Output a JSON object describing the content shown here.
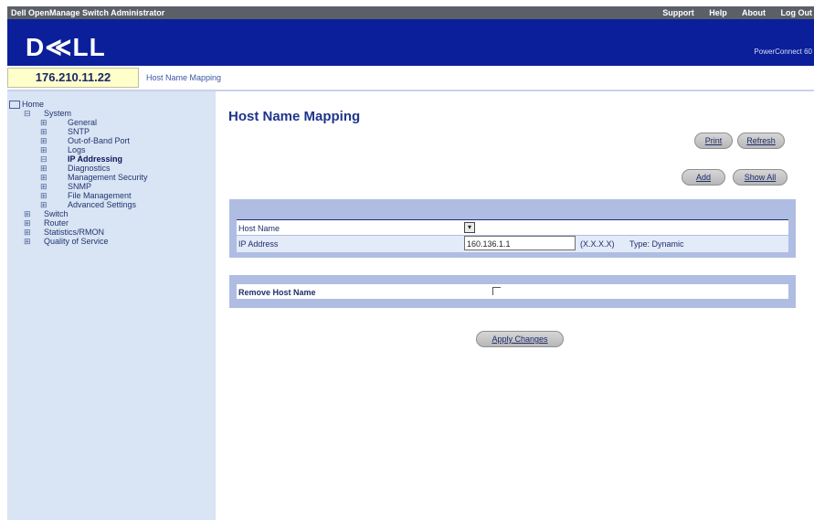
{
  "app_title": "Dell OpenManage Switch Administrator",
  "top_nav": [
    "Support",
    "Help",
    "About",
    "Log Out"
  ],
  "brand": {
    "logo": "D≪LL",
    "product": "PowerConnect 60"
  },
  "address": {
    "ip": "176.210.11.22",
    "breadcrumb": "Host Name Mapping"
  },
  "tree": [
    {
      "label": "Home",
      "level": 0,
      "prefix": ""
    },
    {
      "label": "System",
      "level": 1,
      "prefix": "⊟"
    },
    {
      "label": "General",
      "level": 2,
      "prefix": "⊞"
    },
    {
      "label": "SNTP",
      "level": 2,
      "prefix": "⊞"
    },
    {
      "label": "Out-of-Band Port",
      "level": 2,
      "prefix": "⊞"
    },
    {
      "label": "Logs",
      "level": 2,
      "prefix": "⊞"
    },
    {
      "label": "IP Addressing",
      "level": 2,
      "prefix": "⊟",
      "selected": true
    },
    {
      "label": "Diagnostics",
      "level": 2,
      "prefix": "⊞"
    },
    {
      "label": "Management Security",
      "level": 2,
      "prefix": "⊞"
    },
    {
      "label": "SNMP",
      "level": 2,
      "prefix": "⊞"
    },
    {
      "label": "File Management",
      "level": 2,
      "prefix": "⊞"
    },
    {
      "label": "Advanced Settings",
      "level": 2,
      "prefix": "⊞"
    },
    {
      "label": "Switch",
      "level": 1,
      "prefix": "⊞"
    },
    {
      "label": "Router",
      "level": 1,
      "prefix": "⊞"
    },
    {
      "label": "Statistics/RMON",
      "level": 1,
      "prefix": "⊞"
    },
    {
      "label": "Quality of Service",
      "level": 1,
      "prefix": "⊞"
    }
  ],
  "main": {
    "title": "Host Name Mapping",
    "buttons": {
      "print": "Print",
      "refresh": "Refresh",
      "add": "Add",
      "show_all": "Show All",
      "apply": "Apply Changes"
    },
    "form": {
      "host_name_label": "Host Name",
      "host_name_select": "▾",
      "ip_address_label": "IP Address",
      "ip_address_value": "160.136.1.1",
      "ip_hint": "(X.X.X.X)",
      "type_text": "Type: Dynamic",
      "remove_label": "Remove Host Name"
    }
  }
}
